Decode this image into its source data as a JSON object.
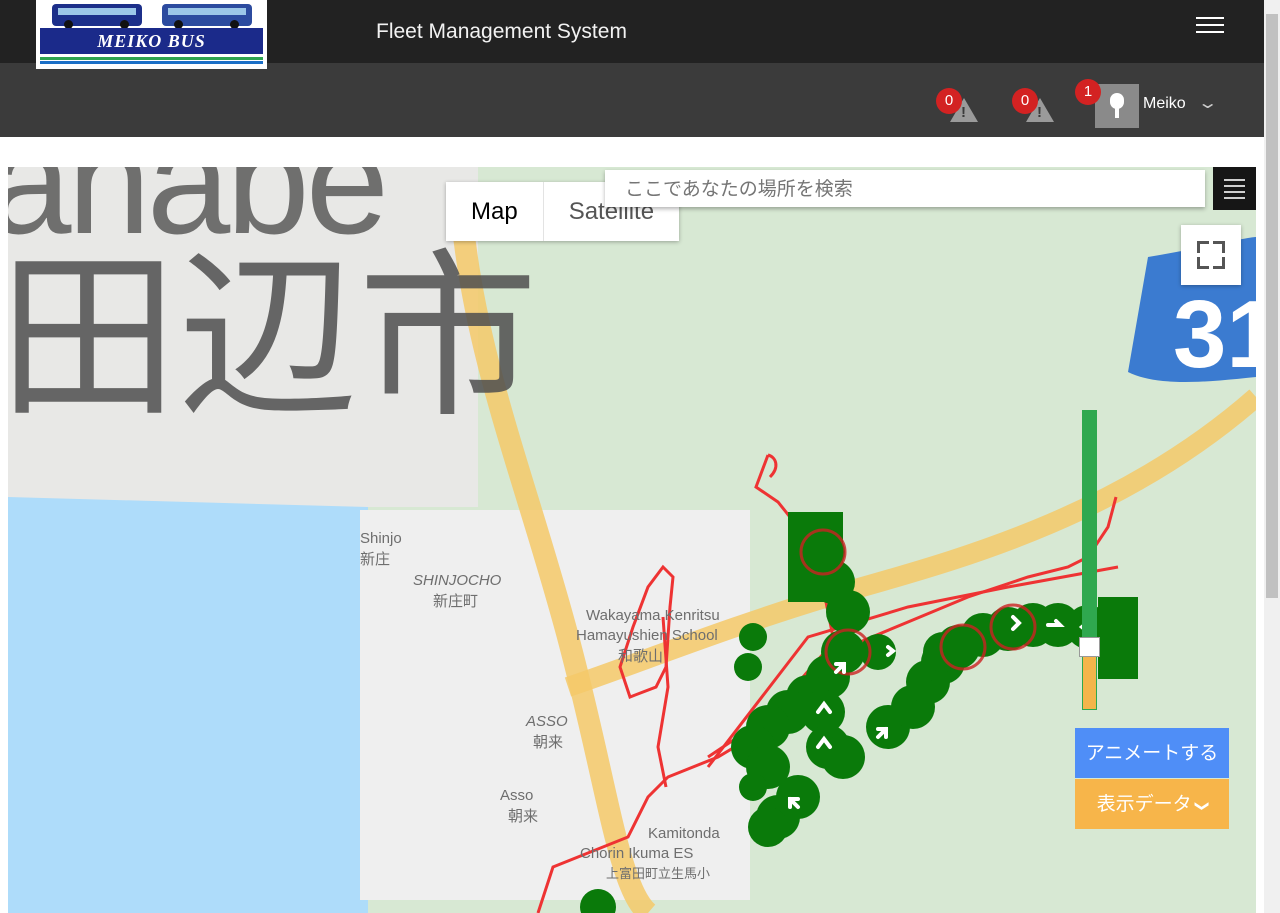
{
  "header": {
    "logo_text": "MEIKO BUS",
    "title": "Fleet Management System"
  },
  "subbar": {
    "alerts": [
      {
        "count": "0"
      },
      {
        "count": "0"
      }
    ],
    "user": {
      "notification_count": "1",
      "name": "Meiko"
    }
  },
  "map": {
    "type_options": [
      "Map",
      "Satellite"
    ],
    "selected_type": "Map",
    "search_placeholder": "ここであなたの場所を検索",
    "area_label_latin": "anabe",
    "area_label_jp": "田辺市",
    "labels": [
      "Shinjo",
      "新庄",
      "SHINJOCHO",
      "新庄町",
      "Wakayama Kenritsu",
      "Hamayushien School",
      "和歌山",
      "ASSO",
      "朝来",
      "Asso",
      "朝来",
      "Kamitonda",
      "Chorin Ikuma ES",
      "上富田町立生馬小"
    ]
  },
  "controls": {
    "animate_label": "アニメートする",
    "display_data_label": "表示データ",
    "playback_progress": 0.79
  },
  "colors": {
    "header_bg": "#222222",
    "subbar_bg": "#3b3b3b",
    "badge_red": "#d32222",
    "route_red": "#ee3333",
    "marker_green": "#0a7a0a",
    "animate_blue": "#4f8ef7",
    "display_orange": "#f7b54a"
  }
}
